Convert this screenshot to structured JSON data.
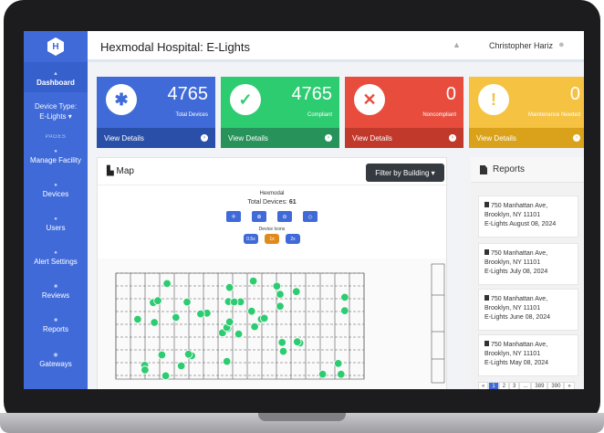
{
  "sidebar": {
    "logo_letter": "H",
    "dashboard_label": "Dashboard",
    "device_type_label": "Device Type:",
    "device_type_value": "E-Lights",
    "pages_heading": "PAGES",
    "items": [
      {
        "label": "Manage Facility"
      },
      {
        "label": "Devices"
      },
      {
        "label": "Users"
      },
      {
        "label": "Alert Settings"
      },
      {
        "label": "Reviews"
      },
      {
        "label": "Reports"
      },
      {
        "label": "Gateways"
      }
    ]
  },
  "header": {
    "title": "Hexmodal Hospital: E-Lights",
    "user_name": "Christopher Hariz"
  },
  "cards": [
    {
      "value": "4765",
      "label": "Total Devices",
      "footer": "View Details",
      "color": "#3f6ad8",
      "footer_color": "#2a4fa8",
      "icon": "lightbulb-icon"
    },
    {
      "value": "4765",
      "label": "Compliant",
      "footer": "View Details",
      "color": "#2ecc71",
      "footer_color": "#27935a",
      "icon": "check-circle-icon"
    },
    {
      "value": "0",
      "label": "Noncompliant",
      "footer": "View Details",
      "color": "#e74c3c",
      "footer_color": "#c0392b",
      "icon": "x-circle-icon"
    },
    {
      "value": "0",
      "label": "Maintenance Needed",
      "footer": "View Details",
      "color": "#f5c242",
      "footer_color": "#d9a21a",
      "icon": "exclamation-circle-icon"
    }
  ],
  "map": {
    "title": "Map",
    "filter_label": "Filter by Building",
    "building": "Hexmodal",
    "total_devices_label": "Total Devices:",
    "total_devices_value": "61",
    "device_icons_label": "Device Icons",
    "sizes": [
      "0.5x",
      "1x",
      "2x"
    ],
    "selected_size": "1x"
  },
  "reports": {
    "title": "Reports",
    "items": [
      {
        "line1": "750 Manhattan Ave,",
        "line2": "Brooklyn, NY 11101",
        "line3": "E-Lights August 08, 2024"
      },
      {
        "line1": "750 Manhattan Ave,",
        "line2": "Brooklyn, NY 11101",
        "line3": "E-Lights July 08, 2024"
      },
      {
        "line1": "750 Manhattan Ave,",
        "line2": "Brooklyn, NY 11101",
        "line3": "E-Lights June 08, 2024"
      },
      {
        "line1": "750 Manhattan Ave,",
        "line2": "Brooklyn, NY 11101",
        "line3": "E-Lights May 08, 2024"
      }
    ],
    "pagination": [
      "«",
      "1",
      "2",
      "3",
      "...",
      "389",
      "390",
      "»"
    ],
    "active_page": "1"
  }
}
